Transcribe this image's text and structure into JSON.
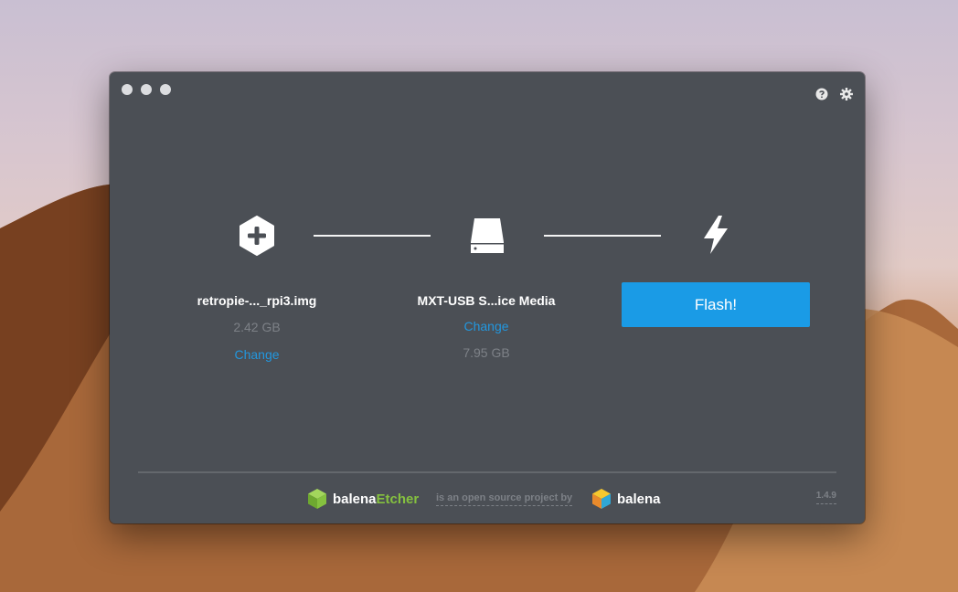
{
  "window": {
    "buttons": [
      "close",
      "minimize",
      "maximize"
    ]
  },
  "toolbar": {
    "help_icon": "help-circle-icon",
    "settings_icon": "gear-icon"
  },
  "steps": {
    "image": {
      "icon": "add-hexagon-icon",
      "name": "retropie-..._rpi3.img",
      "size": "2.42 GB",
      "change_label": "Change"
    },
    "drive": {
      "icon": "drive-icon",
      "name": "MXT-USB S...ice Media",
      "change_label": "Change",
      "size": "7.95 GB"
    },
    "flash": {
      "icon": "lightning-icon",
      "button_label": "Flash!"
    }
  },
  "footer": {
    "app_name_prefix": "balena",
    "app_name_accent": "Etcher",
    "tagline": "is an open source project by",
    "company": "balena",
    "version": "1.4.9"
  },
  "colors": {
    "window_bg": "#4b4f55",
    "accent_blue": "#1a9be6",
    "link_blue": "#2297de",
    "brand_green": "#85c13f"
  }
}
